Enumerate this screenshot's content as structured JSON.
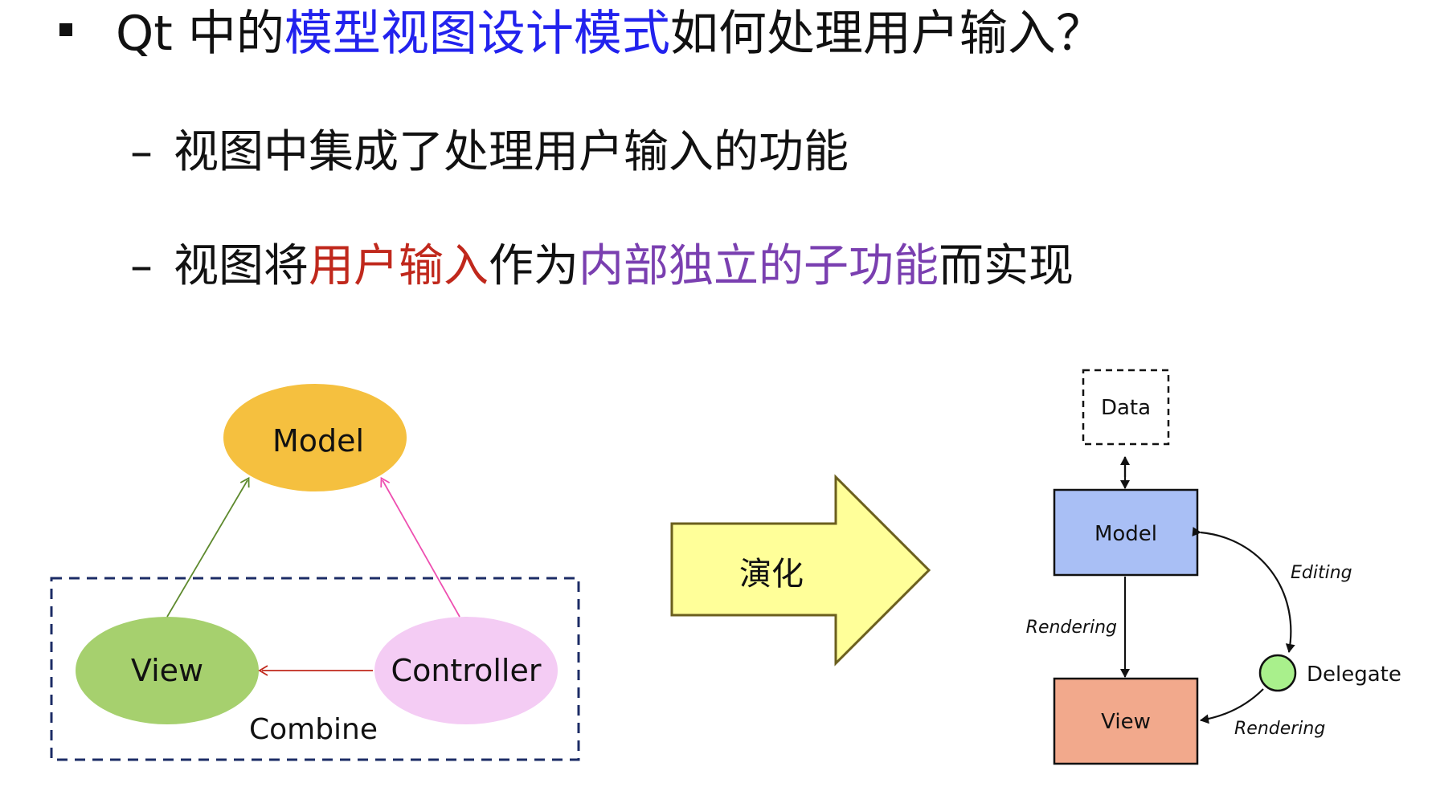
{
  "heading": {
    "prefix": "Qt 中的",
    "highlight": "模型视图设计模式",
    "suffix": "如何处理用户输入？",
    "highlight_color": "#2222ee"
  },
  "points": [
    {
      "dash": "–",
      "text": "视图中集成了处理用户输入的功能"
    },
    {
      "dash": "–",
      "part1": "视图将",
      "part2": "用户输入",
      "part3": "作为",
      "part4": "内部独立的子功能",
      "part5": "而实现",
      "part2_color": "#c0281c",
      "part4_color": "#7a3fb0"
    }
  ],
  "mvc_diagram": {
    "model_label": "Model",
    "view_label": "View",
    "controller_label": "Controller",
    "combine_label": "Combine",
    "model_color": "#f5c03f",
    "view_color": "#a6d06e",
    "controller_color": "#f4ccf4"
  },
  "evolution_arrow": {
    "label": "演化",
    "fill_color": "#ffff99"
  },
  "qt_diagram": {
    "data_label": "Data",
    "model_label": "Model",
    "view_label": "View",
    "delegate_label": "Delegate",
    "editing_label": "Editing",
    "rendering_left_label": "Rendering",
    "rendering_right_label": "Rendering",
    "model_color": "#a9bff5",
    "view_color": "#f2a98c",
    "delegate_color": "#a9f08c"
  }
}
